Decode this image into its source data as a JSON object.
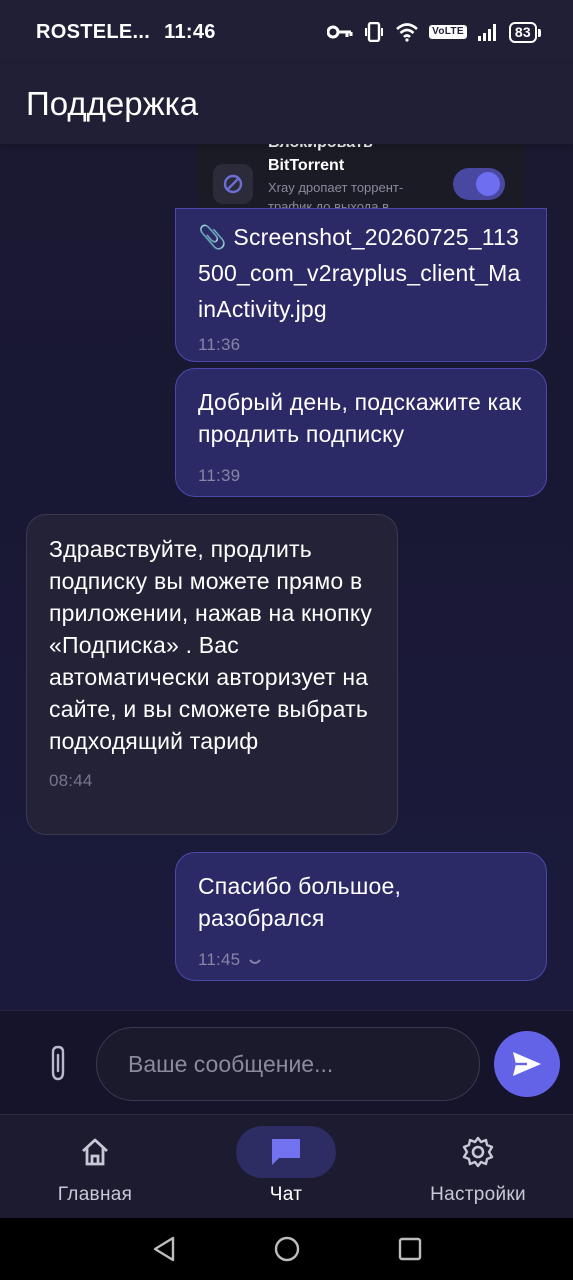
{
  "status_bar": {
    "carrier": "ROSTELE...",
    "time": "11:46",
    "volte": "VoLTE",
    "battery": "83"
  },
  "header": {
    "title": "Поддержка"
  },
  "screenshot_preview": {
    "title_partial": "Блокировать",
    "title": "BitTorrent",
    "subtitle": "Xray дропает торрент-трафик до выхода в"
  },
  "messages": [
    {
      "direction": "out",
      "text": "📎 Screenshot_20260725_113500_com_v2rayplus_client_MainActivity.jpg",
      "time": "11:36"
    },
    {
      "direction": "out",
      "text": "Добрый день, подскажите как продлить подписку",
      "time": "11:39"
    },
    {
      "direction": "in",
      "text": "Здравствуйте, продлить подписку вы можете прямо в приложении, нажав на кнопку «Подписка» . Вас автоматически авторизует на сайте, и вы сможете выбрать подходящий тариф",
      "time": "08:44"
    },
    {
      "direction": "out",
      "text": "Спасибо большое, разобрался",
      "time": "11:45",
      "status_icon": "pending-clock-icon"
    }
  ],
  "composer": {
    "placeholder": "Ваше сообщение...",
    "value": ""
  },
  "bottom_nav": [
    {
      "label": "Главная",
      "icon": "home-icon",
      "active": false
    },
    {
      "label": "Чат",
      "icon": "chat-icon",
      "active": true
    },
    {
      "label": "Настройки",
      "icon": "gear-icon",
      "active": false
    }
  ],
  "colors": {
    "accent": "#6363e8",
    "outgoing_bubble": "#2b2a66",
    "incoming_bubble": "#232237",
    "background": "#191834"
  }
}
